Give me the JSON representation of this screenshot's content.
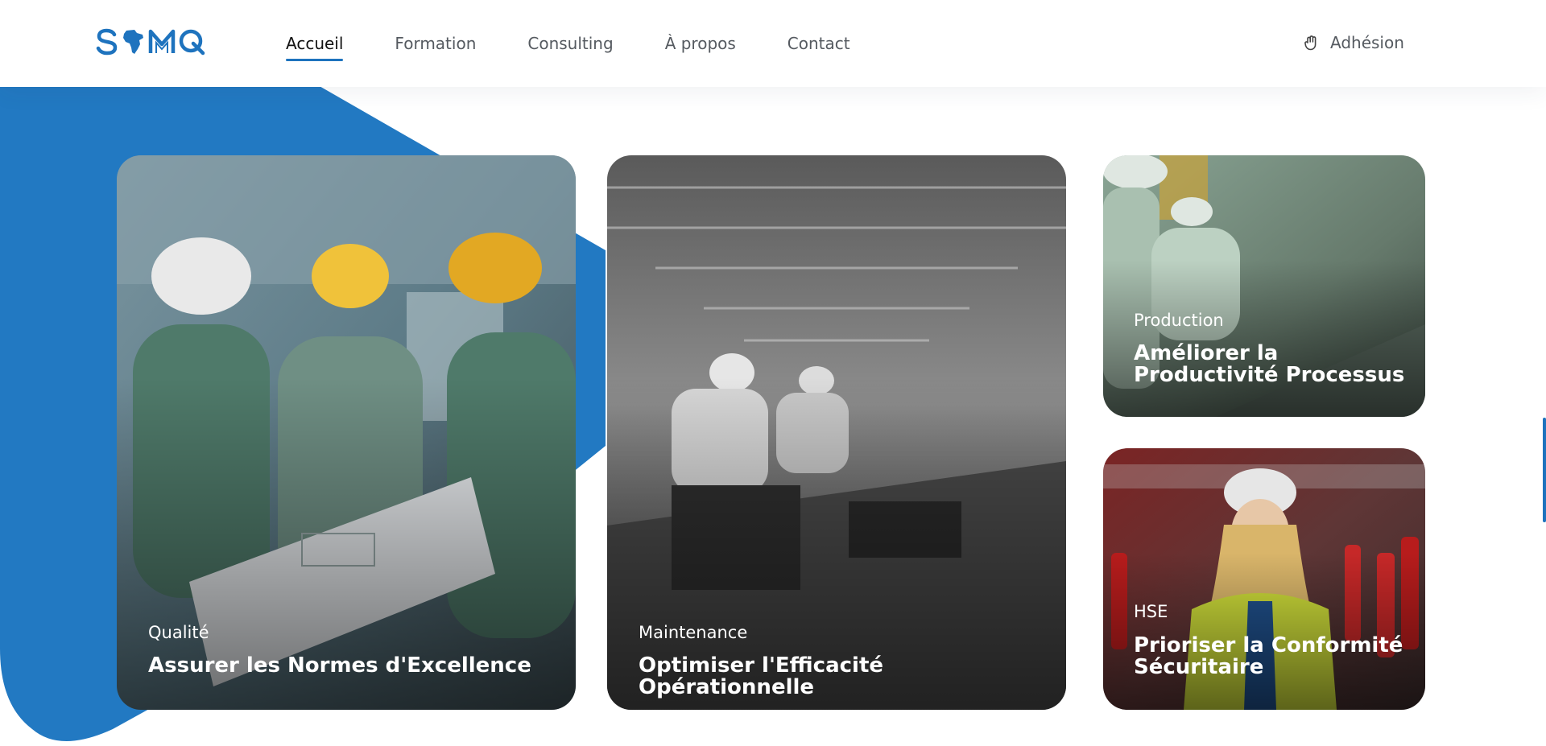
{
  "brand": {
    "logo_text": "SAMQ",
    "accent": "#1e73be"
  },
  "nav": {
    "items": [
      {
        "label": "Accueil",
        "active": true
      },
      {
        "label": "Formation",
        "active": false
      },
      {
        "label": "Consulting",
        "active": false
      },
      {
        "label": "À propos",
        "active": false
      },
      {
        "label": "Contact",
        "active": false
      }
    ]
  },
  "header_action": {
    "label": "Adhésion",
    "icon": "hand-icon"
  },
  "hero": {
    "cards": [
      {
        "category": "Qualité",
        "title": "Assurer les Normes d'Excellence",
        "theme": "#5d7f8a"
      },
      {
        "category": "Maintenance",
        "title": "Optimiser l'Efficacité Opérationnelle",
        "theme": "#6b6b6b"
      },
      {
        "category": "Production",
        "title": "Améliorer la Productivité Processus",
        "theme": "#6f8f7a"
      },
      {
        "category": "HSE",
        "title": "Prioriser la Conformité Sécuritaire",
        "theme": "#8a2a2a"
      }
    ]
  }
}
